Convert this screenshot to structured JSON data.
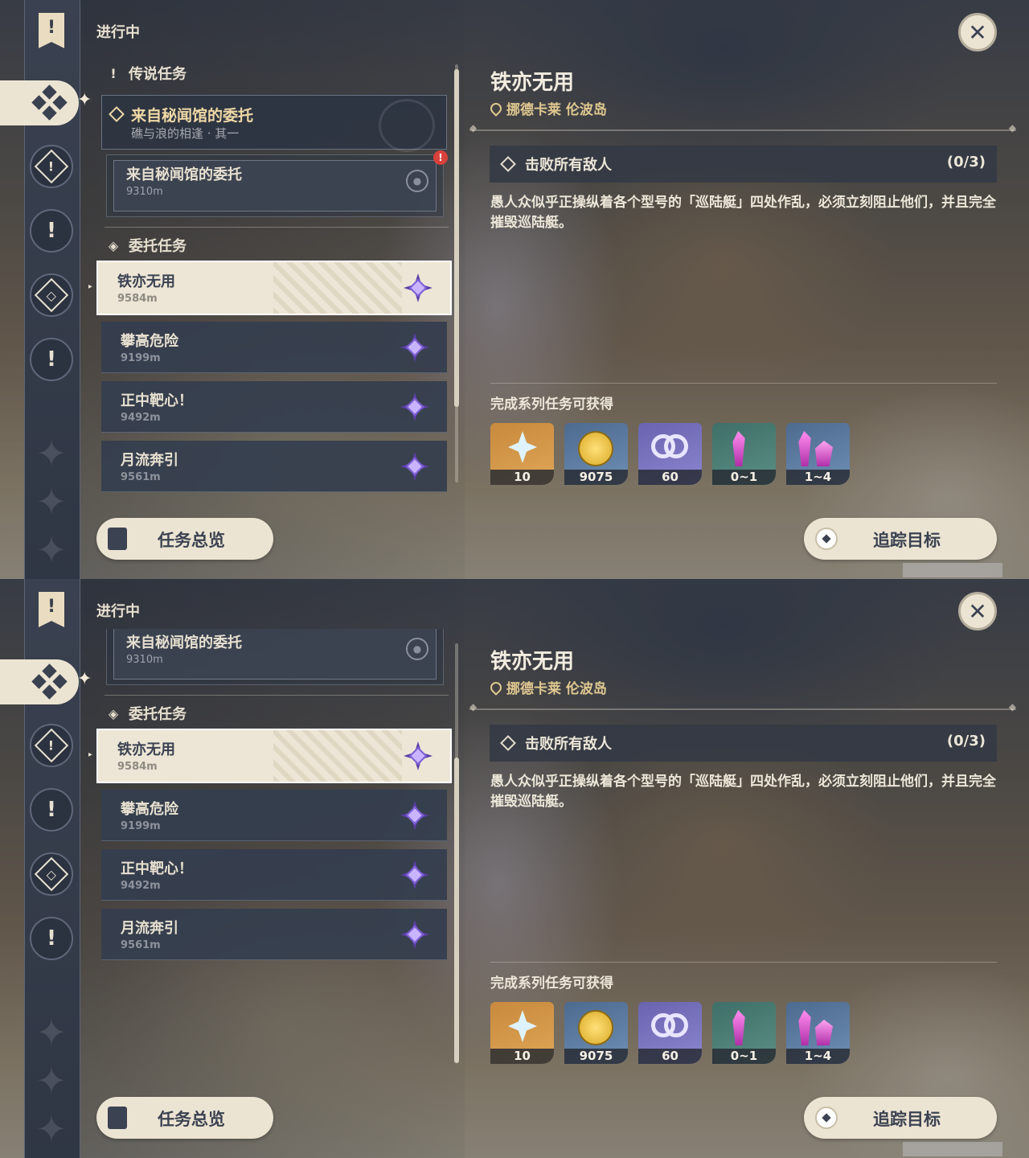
{
  "header": {
    "title": "进行中",
    "close_icon": "close-icon"
  },
  "sidebar": {
    "items": [
      {
        "icon": "quest-banner-icon"
      },
      {
        "icon": "commission-cluster-icon",
        "active": true
      },
      {
        "icon": "archon-quest-icon"
      },
      {
        "icon": "story-quest-icon"
      },
      {
        "icon": "world-quest-icon"
      },
      {
        "icon": "exclamation-icon"
      }
    ]
  },
  "legend_section": {
    "title": "传说任务",
    "card": {
      "title": "来自秘闻馆的委托",
      "subtitle": "礁与浪的相逢 · 其一"
    },
    "sub": {
      "title": "来自秘闻馆的委托",
      "distance": "9310m",
      "alert": "!"
    }
  },
  "commission_section": {
    "title": "委托任务",
    "tasks": [
      {
        "title": "铁亦无用",
        "distance": "9584m"
      },
      {
        "title": "攀高危险",
        "distance": "9199m"
      },
      {
        "title": "正中靶心！",
        "distance": "9492m"
      },
      {
        "title": "月流奔引",
        "distance": "9561m"
      }
    ]
  },
  "buttons": {
    "overview": "任务总览",
    "track": "追踪目标"
  },
  "detail": {
    "title": "铁亦无用",
    "location": "挪德卡莱 伦波岛",
    "objective": {
      "label": "击败所有敌人",
      "count": "(0/3)"
    },
    "description": "愚人众似乎正操纵着各个型号的「巡陆艇」四处作乱，必须立刻阻止他们，并且完全摧毁巡陆艇。",
    "rewards_title": "完成系列任务可获得",
    "rewards": [
      {
        "icon": "primogem-icon",
        "count": "10"
      },
      {
        "icon": "mora-icon",
        "count": "9075"
      },
      {
        "icon": "adventure-exp-icon",
        "count": "60"
      },
      {
        "icon": "crystal-icon",
        "count": "0~1"
      },
      {
        "icon": "crystal-cluster-icon",
        "count": "1~4"
      }
    ]
  },
  "colors": {
    "accent": "#ece4d2",
    "gold": "#e0c890",
    "panel": "#343e4e",
    "gem": "#5a3ea8"
  }
}
